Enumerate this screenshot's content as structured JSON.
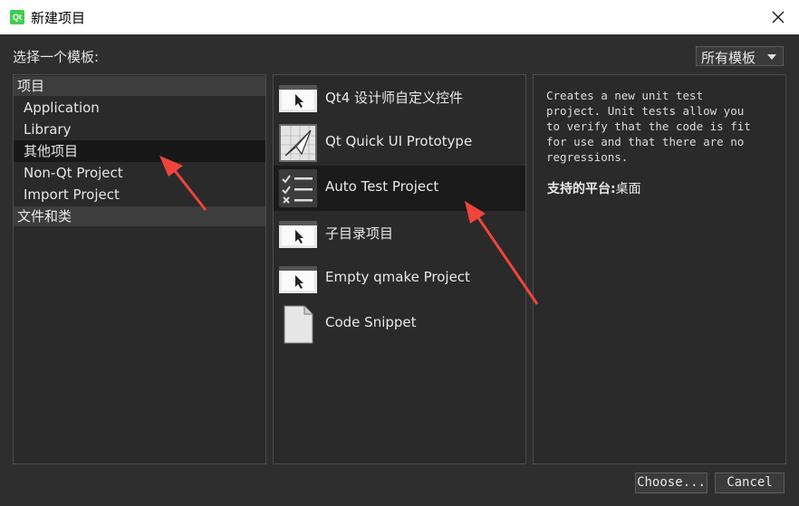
{
  "window": {
    "icon_text": "Qt",
    "title": "新建项目",
    "close_icon": "close-icon"
  },
  "header": {
    "choose_label": "选择一个模板:",
    "filter_value": "所有模板"
  },
  "categories": [
    {
      "label": "项目",
      "kind": "header"
    },
    {
      "label": "Application",
      "kind": "item"
    },
    {
      "label": "Library",
      "kind": "item"
    },
    {
      "label": "其他项目",
      "kind": "item",
      "selected": true
    },
    {
      "label": "Non-Qt Project",
      "kind": "item"
    },
    {
      "label": "Import Project",
      "kind": "item"
    },
    {
      "label": "文件和类",
      "kind": "header"
    }
  ],
  "templates": [
    {
      "label": "Qt4 设计师自定义控件",
      "icon": "monitor-cursor-icon"
    },
    {
      "label": "Qt Quick UI Prototype",
      "icon": "paper-plane-icon"
    },
    {
      "label": "Auto Test Project",
      "icon": "checklist-icon",
      "selected": true
    },
    {
      "label": "子目录项目",
      "icon": "monitor-cursor-icon"
    },
    {
      "label": "Empty qmake Project",
      "icon": "monitor-cursor-icon"
    },
    {
      "label": "Code Snippet",
      "icon": "document-icon"
    }
  ],
  "description": {
    "text": "Creates a new unit test\nproject. Unit tests allow you\nto verify that the code is fit\nfor use and that there are no\nregressions.",
    "platforms_label": "支持的平台:",
    "platforms_value": "桌面"
  },
  "buttons": {
    "choose": "Choose...",
    "cancel": "Cancel"
  },
  "colors": {
    "annotation_arrow": "#f0443c",
    "background": "#2e2e2e",
    "selection": "#181818"
  }
}
